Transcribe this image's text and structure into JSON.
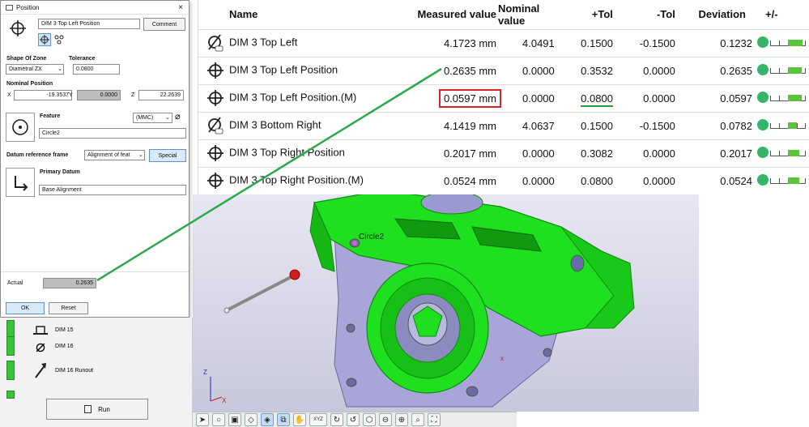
{
  "dialog": {
    "title": "Position",
    "close": "×",
    "name_value": "DIM 3 Top Left Position",
    "comment_label": "Comment",
    "shape_of_zone_label": "Shape Of Zone",
    "shape_of_zone_value": "Diametral ZX",
    "tolerance_label": "Tolerance",
    "tolerance_value": "0.0800",
    "nominal_position_label": "Nominal Position",
    "x_label": "X",
    "x_value": "-19.3537",
    "y_label": "Y",
    "y_value": "0.0000",
    "z_label": "Z",
    "z_value": "22.2639",
    "feature_label": "Feature",
    "mmc_value": "(MMC)",
    "feature_value": "Circle2",
    "datum_frame_label": "Datum reference frame",
    "datum_frame_value": "Alignment of feat",
    "special_label": "Special",
    "primary_datum_label": "Primary Datum",
    "primary_datum_value": "Base Alignment",
    "actual_label": "Actual",
    "actual_value": "0.2635",
    "ok_label": "OK",
    "reset_label": "Reset"
  },
  "feature_list": {
    "items": [
      {
        "label": "DIM 15"
      },
      {
        "label": "DIM 16"
      },
      {
        "label": "DIM 16 Runout"
      }
    ],
    "run_label": "Run"
  },
  "results": {
    "headers": {
      "name": "Name",
      "measured": "Measured value",
      "nominal": "Nominal value",
      "plus_tol": "+Tol",
      "minus_tol": "-Tol",
      "deviation": "Deviation",
      "plusminus": "+/-"
    },
    "rows": [
      {
        "symbol": "diameter",
        "name": "DIM 3 Top Left",
        "measured": "4.1723 mm",
        "nominal": "4.0491",
        "plus_tol": "0.1500",
        "minus_tol": "-0.1500",
        "deviation": "0.1232",
        "fill": 0.82
      },
      {
        "symbol": "position",
        "name": "DIM 3 Top Left Position",
        "measured": "0.2635 mm",
        "nominal": "0.0000",
        "plus_tol": "0.3532",
        "minus_tol": "0.0000",
        "deviation": "0.2635",
        "fill": 0.75
      },
      {
        "symbol": "position",
        "name": "DIM 3 Top Left Position.(M)",
        "measured": "0.0597 mm",
        "nominal": "0.0000",
        "plus_tol": "0.0800",
        "minus_tol": "0.0000",
        "deviation": "0.0597",
        "fill": 0.75
      },
      {
        "symbol": "diameter",
        "name": "DIM 3 Bottom Right",
        "measured": "4.1419 mm",
        "nominal": "4.0637",
        "plus_tol": "0.1500",
        "minus_tol": "-0.1500",
        "deviation": "0.0782",
        "fill": 0.52
      },
      {
        "symbol": "position",
        "name": "DIM 3 Top Right Position",
        "measured": "0.2017 mm",
        "nominal": "0.0000",
        "plus_tol": "0.3082",
        "minus_tol": "0.0000",
        "deviation": "0.2017",
        "fill": 0.65
      },
      {
        "symbol": "position",
        "name": "DIM 3 Top Right Position.(M)",
        "measured": "0.0524 mm",
        "nominal": "0.0000",
        "plus_tol": "0.0800",
        "minus_tol": "0.0000",
        "deviation": "0.0524",
        "fill": 0.65
      }
    ]
  },
  "viewport": {
    "circle_label": "Circle2",
    "axis_z": "Z",
    "axis_x": "X",
    "xyz_label": "XYZ"
  },
  "colors": {
    "part_green": "#1fe01f",
    "part_purple": "#a8a6d8",
    "highlight_red": "#d2262a",
    "underline_green": "#2a9d3b",
    "connector_green": "#2aa84a",
    "status_green": "#33b469"
  }
}
